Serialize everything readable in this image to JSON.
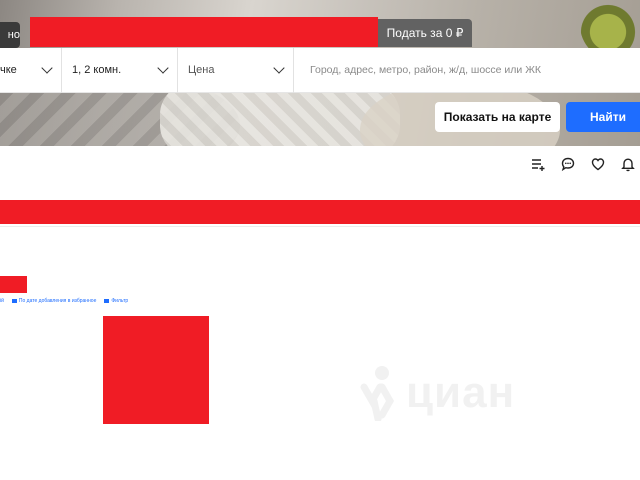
{
  "header": {
    "top_label_partial": "но",
    "post_button": "Подать за 0 ₽"
  },
  "search": {
    "field1_partial": "чке",
    "rooms": "1, 2 комн.",
    "price": "Цена",
    "location_placeholder": "Город, адрес, метро, район, ж/д, шоссе или ЖК",
    "map_button": "Показать на карте",
    "find_button": "Найти"
  },
  "toolbar": {
    "icons": [
      "list-add-icon",
      "chat-icon",
      "heart-icon",
      "bell-icon"
    ]
  },
  "meta_row": {
    "item1": "ій",
    "item2": "По дате добавления в избранное",
    "item3": "Фильтр"
  },
  "watermark": {
    "brand": "циан"
  },
  "colors": {
    "redaction": "#f01c25",
    "primary": "#1e6dff",
    "post_button_bg": "#626262"
  }
}
